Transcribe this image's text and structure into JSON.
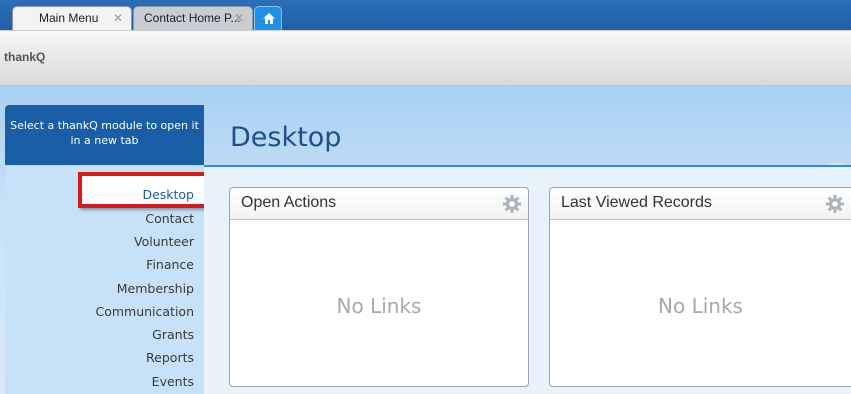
{
  "tabs": [
    {
      "label": "Main Menu",
      "active": true
    },
    {
      "label": "Contact Home P..."
    }
  ],
  "home_tab_icon": "home-icon",
  "app": {
    "title": "thankQ"
  },
  "module_panel": {
    "header": "Select a thankQ module to open it in a new tab",
    "items": [
      "Desktop",
      "Contact",
      "Volunteer",
      "Finance",
      "Membership",
      "Communication",
      "Grants",
      "Reports",
      "Events"
    ],
    "selected": "Desktop"
  },
  "page": {
    "title": "Desktop"
  },
  "widgets": [
    {
      "title": "Open Actions",
      "empty_text": "No Links",
      "icon": "gear-icon"
    },
    {
      "title": "Last Viewed Records",
      "empty_text": "No Links",
      "icon": "gear-icon"
    }
  ],
  "colors": {
    "tab_bar": "#1f5fa8",
    "module_header": "#1a5ea6",
    "highlight": "#d91a1a",
    "title": "#1d4f8a"
  }
}
